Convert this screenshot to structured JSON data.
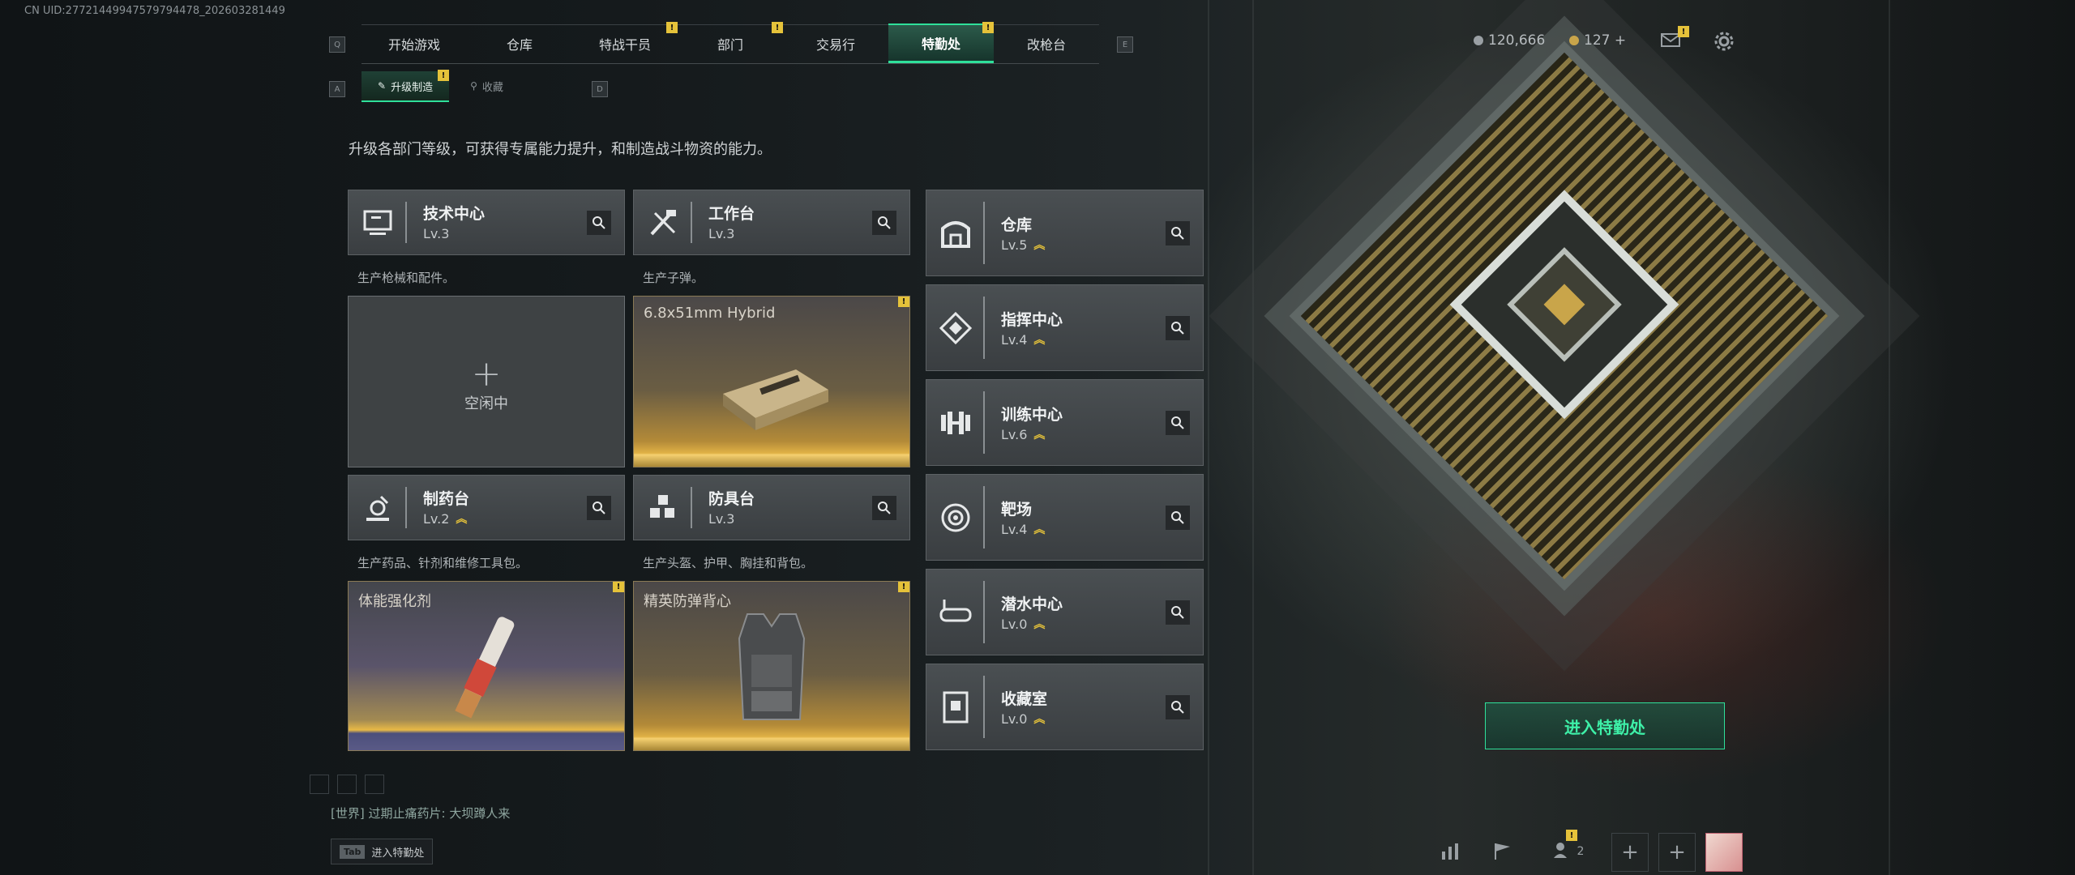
{
  "uid_text": "CN UID:277214499475797944​78_202603281449",
  "nav": {
    "left_key": "Q",
    "right_key": "E",
    "tabs": [
      {
        "label": "开始游戏",
        "alert": false,
        "active": false
      },
      {
        "label": "仓库",
        "alert": false,
        "active": false
      },
      {
        "label": "特战干员",
        "alert": true,
        "active": false
      },
      {
        "label": "部门",
        "alert": true,
        "active": false
      },
      {
        "label": "交易行",
        "alert": false,
        "active": false
      },
      {
        "label": "特勤处",
        "alert": true,
        "active": true
      },
      {
        "label": "改枪台",
        "alert": false,
        "active": false
      }
    ]
  },
  "currency": {
    "coins": "120,666",
    "tickets": "127 +"
  },
  "subnav": {
    "left_key": "A",
    "right_key": "D",
    "tabs": [
      {
        "label": "升级制造",
        "active": true
      },
      {
        "label": "收藏",
        "active": false
      }
    ]
  },
  "description": "升级各部门等级，可获得专属能力提升，和制造战斗物资的能力。",
  "production": [
    {
      "name": "技术中心",
      "level": "Lv.3",
      "upgradable": false,
      "desc": "生产枪械和配件。",
      "slot": {
        "state": "idle",
        "plus": "+",
        "text": "空闲中"
      }
    },
    {
      "name": "工作台",
      "level": "Lv.3",
      "upgradable": false,
      "desc": "生产子弹。",
      "slot": {
        "state": "producing",
        "item": "6.8x51mm Hybrid"
      }
    },
    {
      "name": "制药台",
      "level": "Lv.2",
      "upgradable": true,
      "desc": "生产药品、针剂和维修工具包。",
      "slot": {
        "state": "producing",
        "item": "体能强化剂"
      }
    },
    {
      "name": "防具台",
      "level": "Lv.3",
      "upgradable": false,
      "desc": "生产头盔、护甲、胸挂和背包。",
      "slot": {
        "state": "producing",
        "item": "精英防弹背心"
      }
    }
  ],
  "facilities": [
    {
      "name": "仓库",
      "level": "Lv.5",
      "upgradable": true,
      "icon": "warehouse-icon"
    },
    {
      "name": "指挥中心",
      "level": "Lv.4",
      "upgradable": true,
      "icon": "command-icon"
    },
    {
      "name": "训练中心",
      "level": "Lv.6",
      "upgradable": true,
      "icon": "dumbbell-icon"
    },
    {
      "name": "靶场",
      "level": "Lv.4",
      "upgradable": true,
      "icon": "target-icon"
    },
    {
      "name": "潜水中心",
      "level": "Lv.0",
      "upgradable": true,
      "icon": "diving-mask-icon"
    },
    {
      "name": "收藏室",
      "level": "Lv.0",
      "upgradable": true,
      "icon": "display-case-icon"
    }
  ],
  "enter_button": "进入特勤处",
  "chat": {
    "channel": "[世界]",
    "message": "过期止痛药片: 大坝蹲人来"
  },
  "tab_hint": {
    "key": "Tab",
    "label": "进入特勤处"
  },
  "bottom_bar": {
    "team_count": "2",
    "team_alert": true
  },
  "colors": {
    "accent": "#2fe09a",
    "alert": "#e5c23a",
    "card_bg": "#45494c"
  }
}
